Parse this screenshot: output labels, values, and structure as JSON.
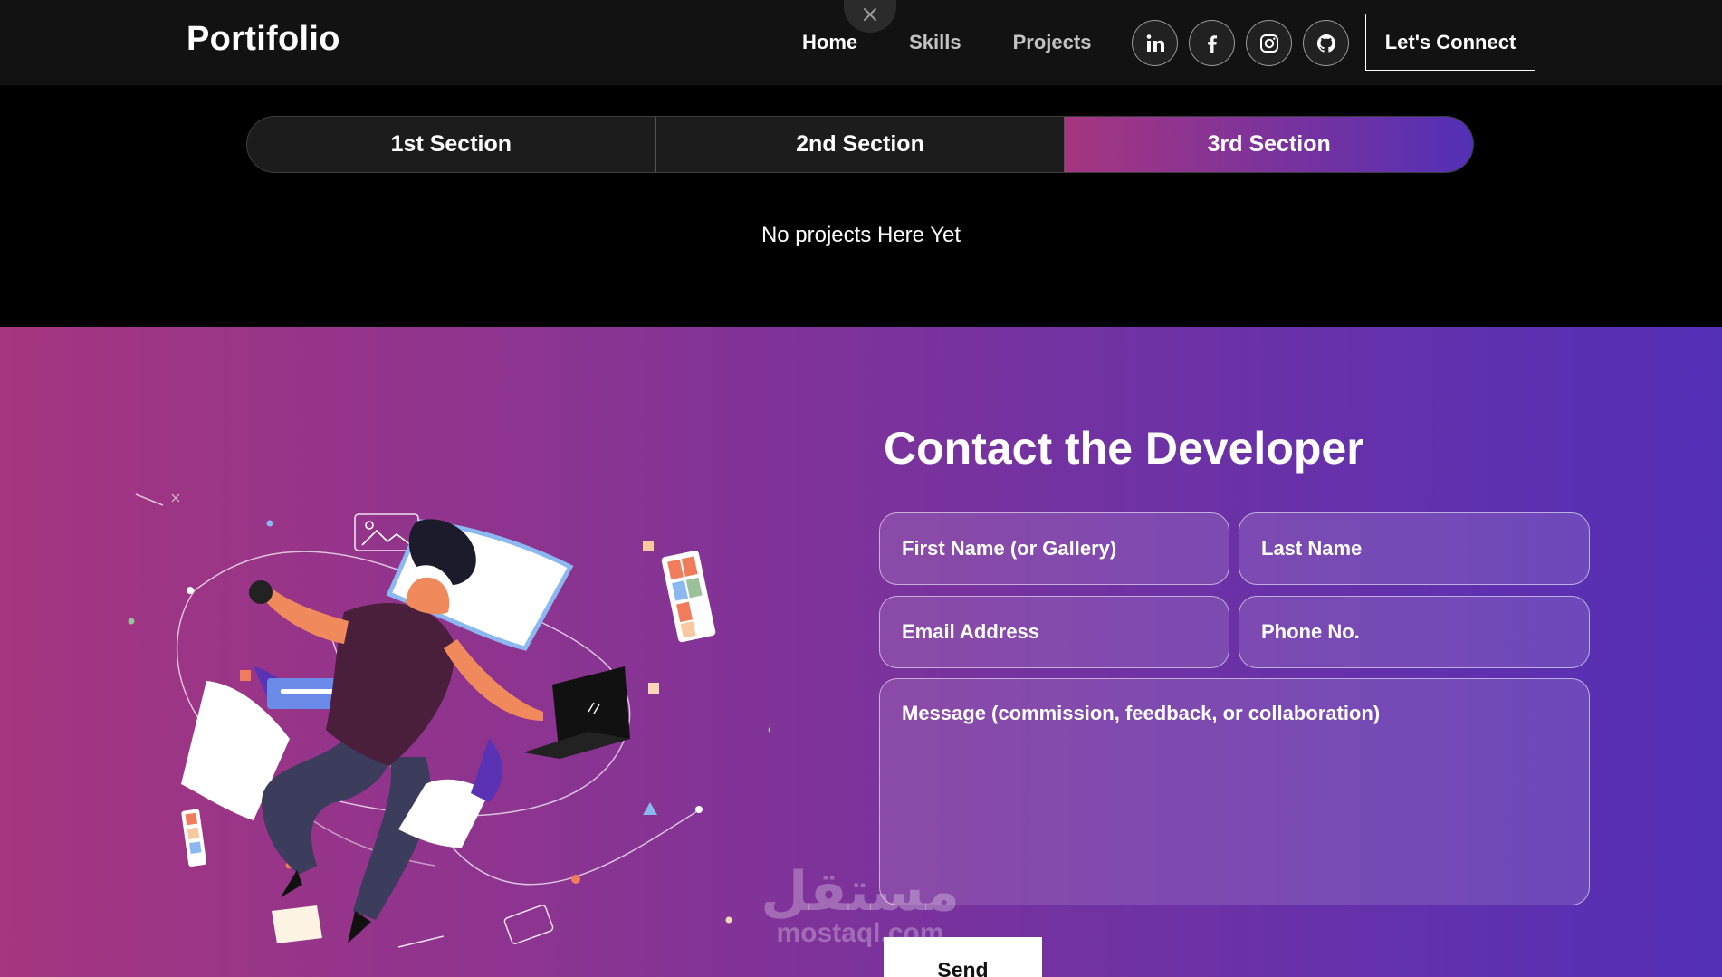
{
  "navbar": {
    "brand": "Portifolio",
    "links": [
      {
        "label": "Home",
        "active": true
      },
      {
        "label": "Skills",
        "active": false
      },
      {
        "label": "Projects",
        "active": false
      }
    ],
    "socials": [
      "linkedin-icon",
      "facebook-icon",
      "instagram-icon",
      "github-icon"
    ],
    "connect_label": "Let's Connect"
  },
  "projects": {
    "tabs": [
      {
        "label": "1st Section",
        "active": false
      },
      {
        "label": "2nd Section",
        "active": false
      },
      {
        "label": "3rd Section",
        "active": true
      }
    ],
    "empty_message": "No projects Here Yet"
  },
  "contact": {
    "title": "Contact the Developer",
    "placeholders": {
      "first_name": "First Name (or Gallery)",
      "last_name": "Last Name",
      "email": "Email Address",
      "phone": "Phone No.",
      "message": "Message (commission, feedback, or collaboration)"
    },
    "send_label": "Send"
  },
  "watermark": {
    "arabic": "مستقل",
    "latin": "mostaql.com"
  },
  "colors": {
    "gradient_start": "#AA367C",
    "gradient_end": "#4A2FBD",
    "navbar_bg": "#121212",
    "page_bg": "#000000"
  }
}
